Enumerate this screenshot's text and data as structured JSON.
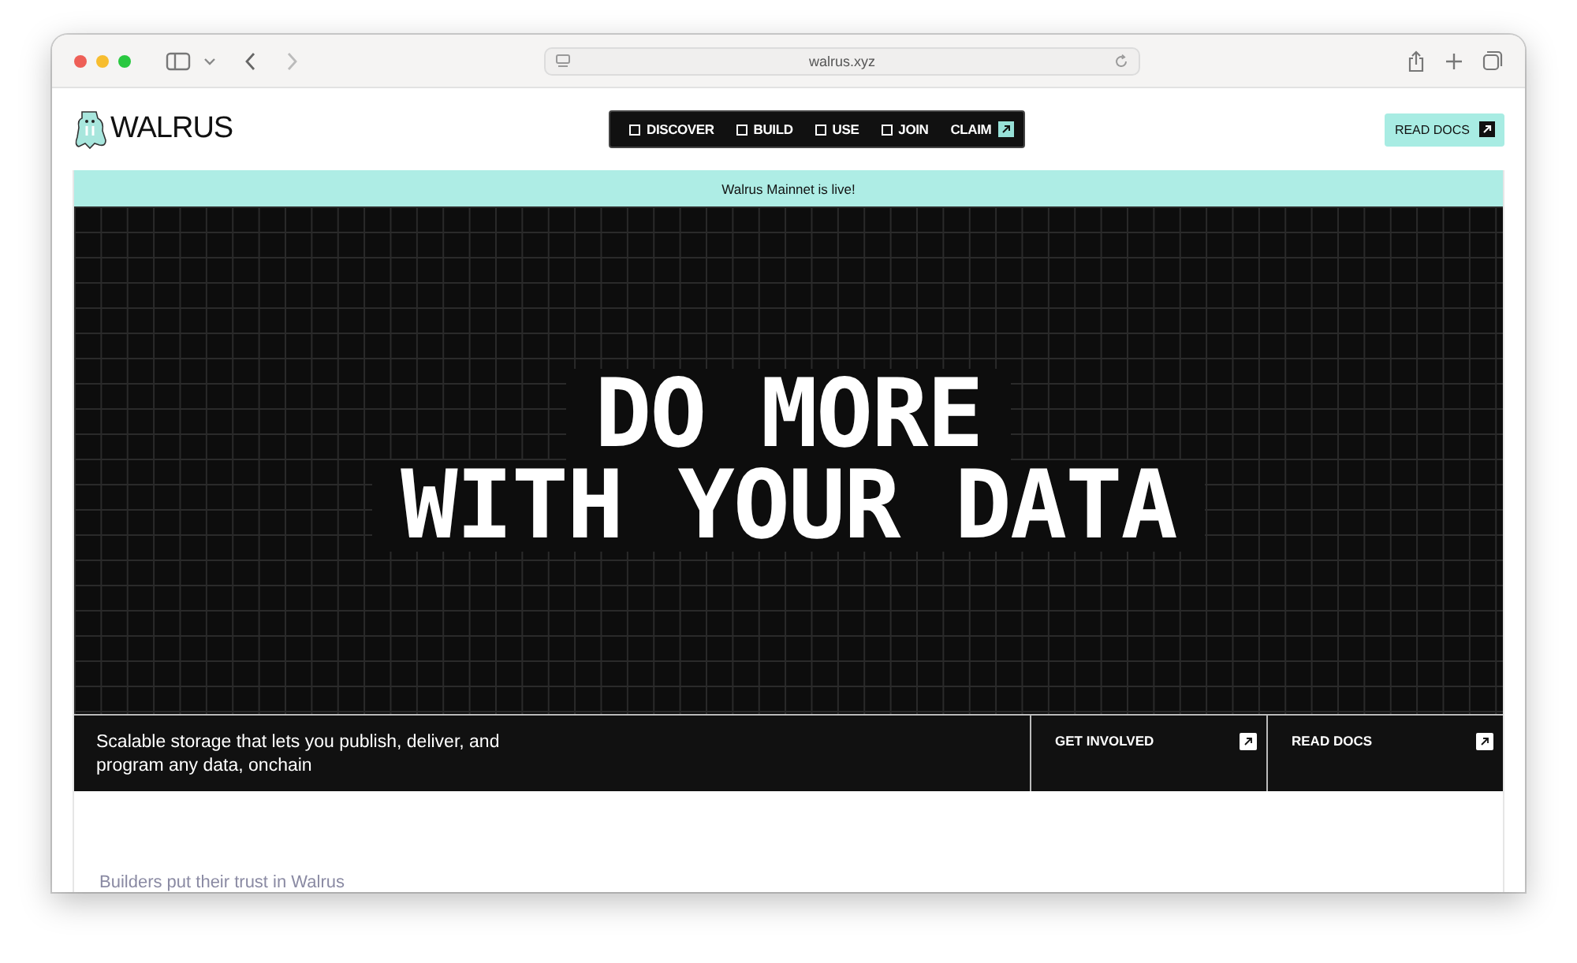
{
  "browser": {
    "url": "walrus.xyz"
  },
  "header": {
    "logo": "WALRUS",
    "nav": [
      {
        "label": "DISCOVER",
        "kind": "square"
      },
      {
        "label": "BUILD",
        "kind": "square"
      },
      {
        "label": "USE",
        "kind": "square"
      },
      {
        "label": "JOIN",
        "kind": "square"
      },
      {
        "label": "CLAIM",
        "kind": "external"
      }
    ],
    "cta": "READ DOCS"
  },
  "banner": "Walrus Mainnet is live!",
  "hero": {
    "title_lines": [
      "DO MORE",
      "WITH YOUR DATA"
    ]
  },
  "strip": {
    "tagline": "Scalable storage that lets you publish, deliver, and program any data, onchain",
    "links": [
      "GET INVOLVED",
      "READ DOCS"
    ]
  },
  "section_heading": "Builders put their trust in Walrus"
}
